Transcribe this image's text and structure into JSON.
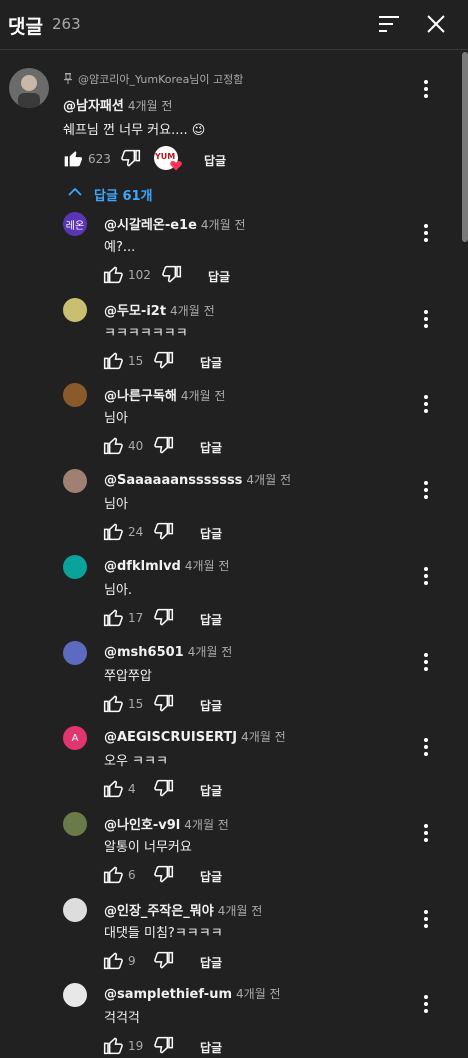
{
  "header": {
    "title": "댓글",
    "count": "263"
  },
  "top_comment": {
    "pinned_label": "@얌코리아_YumKorea님이 고정함",
    "author": "@남자패션",
    "time": "4개월 전",
    "text": "쉐프님 껀 너무 커요.... 😉",
    "likes": "623",
    "reply_label": "답글",
    "creator_badge": "YUM",
    "replies_toggle": "답글 61개"
  },
  "replies": [
    {
      "author": "@시갈레온-e1e",
      "time": "4개월 전",
      "text": "예?...",
      "likes": "102",
      "reply_label": "답글",
      "avatar_text": "레온",
      "avatar_color": "#5a35b5"
    },
    {
      "author": "@두모-i2t",
      "time": "4개월 전",
      "text": "ㅋㅋㅋㅋㅋㅋㅋ",
      "likes": "15",
      "reply_label": "답글",
      "avatar_text": "",
      "avatar_color": "#c8c070"
    },
    {
      "author": "@나른구독해",
      "time": "4개월 전",
      "text": "님아",
      "likes": "40",
      "reply_label": "답글",
      "avatar_text": "",
      "avatar_color": "#8a5a2a"
    },
    {
      "author": "@Saaaaaansssssss",
      "time": "4개월 전",
      "text": "님아",
      "likes": "24",
      "reply_label": "답글",
      "avatar_text": "",
      "avatar_color": "#a08070"
    },
    {
      "author": "@dfklmlvd",
      "time": "4개월 전",
      "text": "님아.",
      "likes": "17",
      "reply_label": "답글",
      "avatar_text": "",
      "avatar_color": "#0aa39b"
    },
    {
      "author": "@msh6501",
      "time": "4개월 전",
      "text": "쭈압쭈압",
      "likes": "15",
      "reply_label": "답글",
      "avatar_text": "",
      "avatar_color": "#5c6bc0"
    },
    {
      "author": "@AEGISCRUISERTJ",
      "time": "4개월 전",
      "text": "오우 ㅋㅋㅋ",
      "likes": "4",
      "reply_label": "답글",
      "avatar_text": "A",
      "avatar_color": "#e0356e"
    },
    {
      "author": "@나인호-v9l",
      "time": "4개월 전",
      "text": "알통이 너무커요",
      "likes": "6",
      "reply_label": "답글",
      "avatar_text": "",
      "avatar_color": "#6a7a4a"
    },
    {
      "author": "@인장_주작은_뭐야",
      "time": "4개월 전",
      "text": "대댓들 미침?ㅋㅋㅋㅋ",
      "likes": "9",
      "reply_label": "답글",
      "avatar_text": "",
      "avatar_color": "#dddddd"
    },
    {
      "author": "@samplethief-um",
      "time": "4개월 전",
      "text": "걱걱걱",
      "likes": "19",
      "reply_label": "답글",
      "avatar_text": "",
      "avatar_color": "#e8e8e8"
    }
  ]
}
